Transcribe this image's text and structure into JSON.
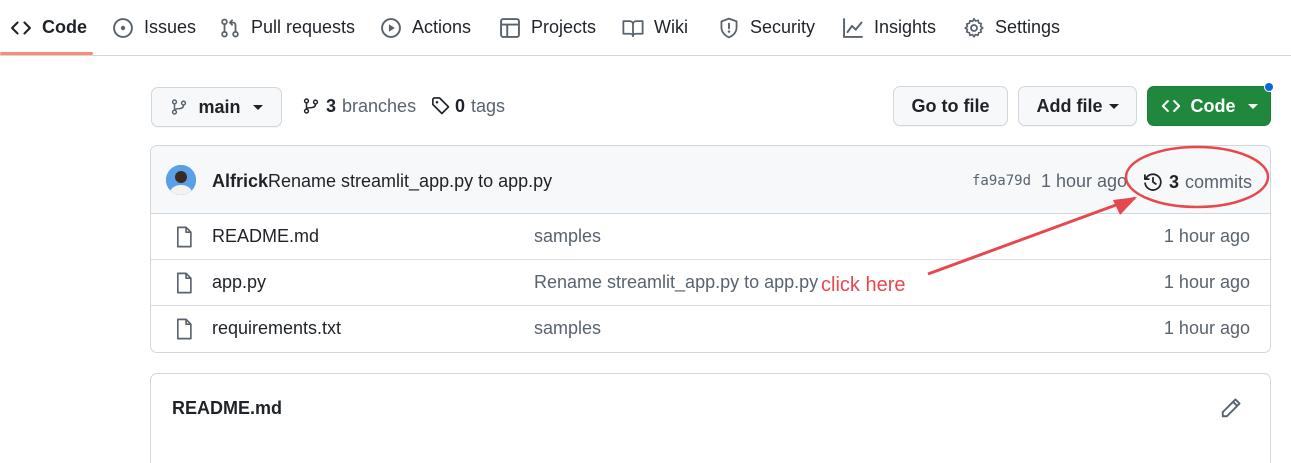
{
  "nav": {
    "tabs": [
      {
        "label": "Code",
        "icon": "code-icon",
        "selected": true
      },
      {
        "label": "Issues",
        "icon": "issue-opened-icon"
      },
      {
        "label": "Pull requests",
        "icon": "git-pull-request-icon"
      },
      {
        "label": "Actions",
        "icon": "play-icon"
      },
      {
        "label": "Projects",
        "icon": "table-icon"
      },
      {
        "label": "Wiki",
        "icon": "book-icon"
      },
      {
        "label": "Security",
        "icon": "shield-icon"
      },
      {
        "label": "Insights",
        "icon": "graph-icon"
      },
      {
        "label": "Settings",
        "icon": "gear-icon"
      }
    ],
    "selected_underline_color": "#fd8c73"
  },
  "toolbar": {
    "branch": "main",
    "branches_count": "3",
    "branches_label": "branches",
    "tags_count": "0",
    "tags_label": "tags",
    "go_to_file_label": "Go to file",
    "add_file_label": "Add file",
    "code_label": "Code",
    "code_button_color": "#1f883d",
    "notification_dot_color": "#0969da"
  },
  "latest_commit": {
    "author": "Alfrick",
    "message": "Rename streamlit_app.py to app.py",
    "sha": "fa9a79d",
    "time": "1 hour ago",
    "commits_count": "3",
    "commits_label": "commits"
  },
  "files": [
    {
      "name": "README.md",
      "message": "samples",
      "time": "1 hour ago"
    },
    {
      "name": "app.py",
      "message": "Rename streamlit_app.py to app.py",
      "time": "1 hour ago"
    },
    {
      "name": "requirements.txt",
      "message": "samples",
      "time": "1 hour ago"
    }
  ],
  "annotation": {
    "text": "click here",
    "color": "#e5484d"
  },
  "readme": {
    "title": "README.md"
  }
}
